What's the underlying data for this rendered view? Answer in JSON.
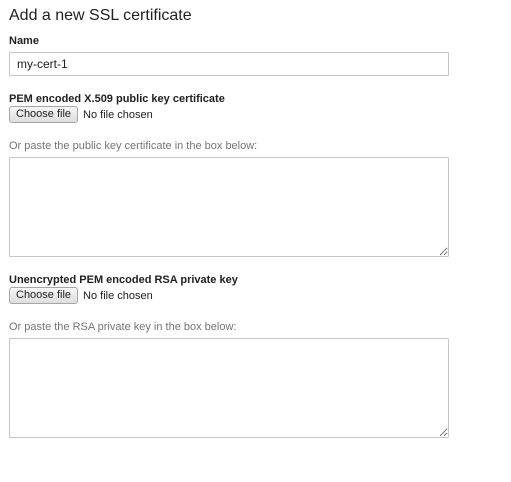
{
  "page": {
    "title": "Add a new SSL certificate"
  },
  "name_field": {
    "label": "Name",
    "value": "my-cert-1"
  },
  "certificate": {
    "label": "PEM encoded X.509 public key certificate",
    "choose_button": "Choose file",
    "file_status": "No file chosen",
    "paste_hint": "Or paste the public key certificate in the box below:",
    "textarea_value": ""
  },
  "private_key": {
    "label": "Unencrypted PEM encoded RSA private key",
    "choose_button": "Choose file",
    "file_status": "No file chosen",
    "paste_hint": "Or paste the RSA private key in the box below:",
    "textarea_value": ""
  },
  "colors": {
    "text": "#212121",
    "hint": "#757575",
    "border": "#c6c6c6"
  }
}
